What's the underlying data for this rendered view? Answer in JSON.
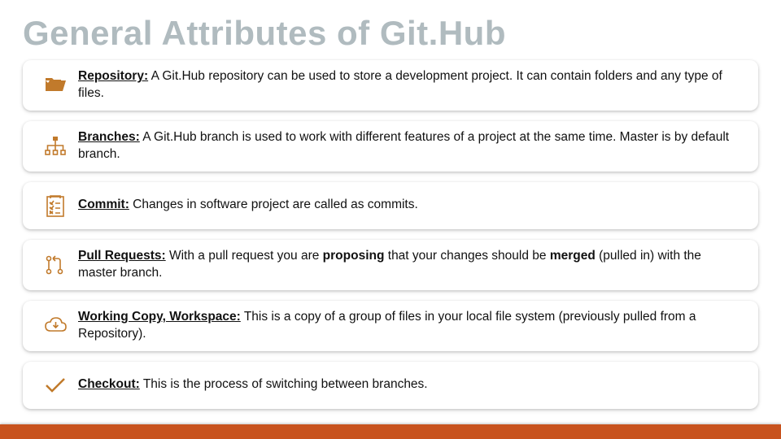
{
  "title": "General Attributes of Git.Hub",
  "items": [
    {
      "icon": "folder-open-icon",
      "term": "Repository:",
      "desc_parts": [
        {
          "text": " A Git.Hub repository can be used to store a development project. It can contain folders and any type of files.",
          "bold": false
        }
      ]
    },
    {
      "icon": "hierarchy-icon",
      "term": "Branches:",
      "desc_parts": [
        {
          "text": " A Git.Hub branch is used to work with different features of a project at the same time. Master is by default branch.",
          "bold": false
        }
      ]
    },
    {
      "icon": "checklist-icon",
      "term": "Commit:",
      "desc_parts": [
        {
          "text": " Changes in software project are called as commits.",
          "bold": false
        }
      ]
    },
    {
      "icon": "pull-request-icon",
      "term": "Pull Requests:",
      "desc_parts": [
        {
          "text": " With a pull request you are ",
          "bold": false
        },
        {
          "text": "proposing",
          "bold": true
        },
        {
          "text": " that your changes should be ",
          "bold": false
        },
        {
          "text": "merged",
          "bold": true
        },
        {
          "text": " (pulled in) with the master branch.",
          "bold": false
        }
      ]
    },
    {
      "icon": "cloud-download-icon",
      "term": "Working Copy, Workspace:",
      "desc_parts": [
        {
          "text": " This is a copy of a group of files in your local file system (previously pulled from a Repository).",
          "bold": false
        }
      ]
    },
    {
      "icon": "check-icon",
      "term": "Checkout:",
      "desc_parts": [
        {
          "text": " This is the process of switching between branches.",
          "bold": false
        }
      ]
    }
  ],
  "colors": {
    "accent": "#c8531e",
    "icon_stroke": "#c17a2b",
    "title_color": "#b0bbbf"
  }
}
